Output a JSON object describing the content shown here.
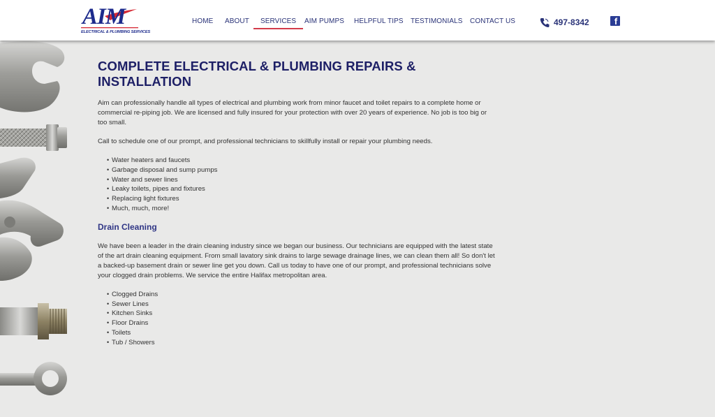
{
  "header": {
    "logo": {
      "word": "AIM",
      "subtitle": "ELECTRICAL & PLUMBING SERVICES"
    },
    "nav": [
      {
        "label": "HOME",
        "active": false
      },
      {
        "label": "ABOUT",
        "active": false
      },
      {
        "label": "SERVICES",
        "active": true
      },
      {
        "label": "AIM PUMPS",
        "active": false
      },
      {
        "label": "HELPFUL TIPS",
        "active": false
      },
      {
        "label": "TESTIMONIALS",
        "active": false
      },
      {
        "label": "CONTACT US",
        "active": false
      }
    ],
    "phone": "497-8342",
    "facebook_icon": "facebook-icon"
  },
  "main": {
    "title": "COMPLETE ELECTRICAL & PLUMBING REPAIRS & INSTALLATION",
    "intro": "Aim can professionally handle all types of electrical and plumbing work from minor faucet and toilet repairs to a complete home or commercial re-piping job. We are licensed and fully insured for your protection with over 20 years of experience. No job is too big or too small.",
    "call": "Call to schedule one of our prompt, and professional technicians to skillfully install or repair your plumbing needs.",
    "plumbing_list": [
      "Water heaters and faucets",
      "Garbage disposal and sump pumps",
      "Water and sewer lines",
      "Leaky toilets, pipes and fixtures",
      "Replacing light fixtures",
      "Much, much, more!"
    ],
    "drain_heading": "Drain Cleaning",
    "drain_text": "We have been a leader in the drain cleaning industry since we began our business. Our technicians are equipped with the latest state of the art drain cleaning equipment. From small lavatory sink drains to large sewage drainage lines, we can clean them all! So don't let a backed-up basement drain or sewer line get you down. Call us today to have one of our prompt, and professional technicians solve your clogged drain problems. We service the entire Halifax metropolitan area.",
    "drain_list": [
      "Clogged Drains",
      "Sewer Lines",
      "Kitchen Sinks",
      "Floor Drains",
      "Toilets",
      "Tub / Showers"
    ]
  },
  "colors": {
    "brand_navy": "#1d1f66",
    "nav_text": "#2a3378",
    "active_underline": "#d33a4a",
    "logo_red": "#d62a35"
  }
}
